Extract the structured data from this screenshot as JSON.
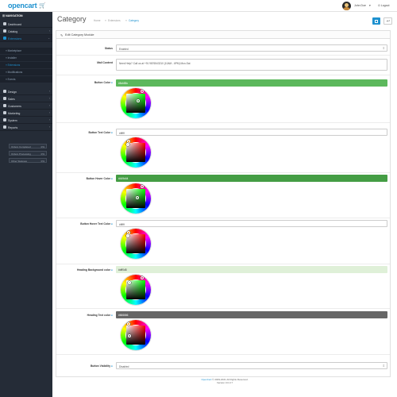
{
  "topbar": {
    "logo": "opencart",
    "user_name": "John Doe",
    "logout": "Logout"
  },
  "sidebar": {
    "heading": "NAVIGATION",
    "items": [
      {
        "label": "Dashboard"
      },
      {
        "label": "Catalog"
      },
      {
        "label": "Extensions"
      },
      {
        "label": "Design"
      },
      {
        "label": "Sales"
      },
      {
        "label": "Customers"
      },
      {
        "label": "Marketing"
      },
      {
        "label": "System"
      },
      {
        "label": "Reports"
      }
    ],
    "subitems": [
      {
        "label": "Marketplace"
      },
      {
        "label": "Installer"
      },
      {
        "label": "Extensions"
      },
      {
        "label": "Modifications"
      },
      {
        "label": "Events"
      }
    ],
    "stats": [
      {
        "label": "Orders Completed",
        "value": "0%"
      },
      {
        "label": "Orders Processing",
        "value": "0%"
      },
      {
        "label": "Other Statuses",
        "value": "0%"
      }
    ]
  },
  "header": {
    "title": "Category",
    "breadcrumbs": [
      "Home",
      "Extensions",
      "Category"
    ]
  },
  "panel": {
    "title": "Edit Category Module",
    "status": {
      "label": "Status",
      "value": "Enabled"
    },
    "mail_content": {
      "label": "Mail Content",
      "value": "Need Help? Call us at +91 9876543210 (10AM - 6PM) Mon-Sat"
    },
    "button_color": {
      "label": "Button Color",
      "value": "#5cb85c"
    },
    "button_text_color": {
      "label": "Button Text Color",
      "value": "#ffffff"
    },
    "button_hover_color": {
      "label": "Button Hover Color",
      "value": "#449d44"
    },
    "button_hover_text_color": {
      "label": "Button Hover Text Color",
      "value": "#ffffff"
    },
    "heading_bg_color": {
      "label": "Heading Background color",
      "value": "#dff0d8"
    },
    "heading_text_color": {
      "label": "Heading Text color",
      "value": "#666666"
    },
    "button_visibility": {
      "label": "Button Visibility",
      "value": "Disabled"
    }
  },
  "footer": {
    "link": "OpenCart",
    "copyright": "© 2009-2021 All Rights Reserved.",
    "version": "Version 3.0.3.7"
  },
  "colors": {
    "accent": "#1e91cf",
    "sidebar": "#252c37"
  }
}
